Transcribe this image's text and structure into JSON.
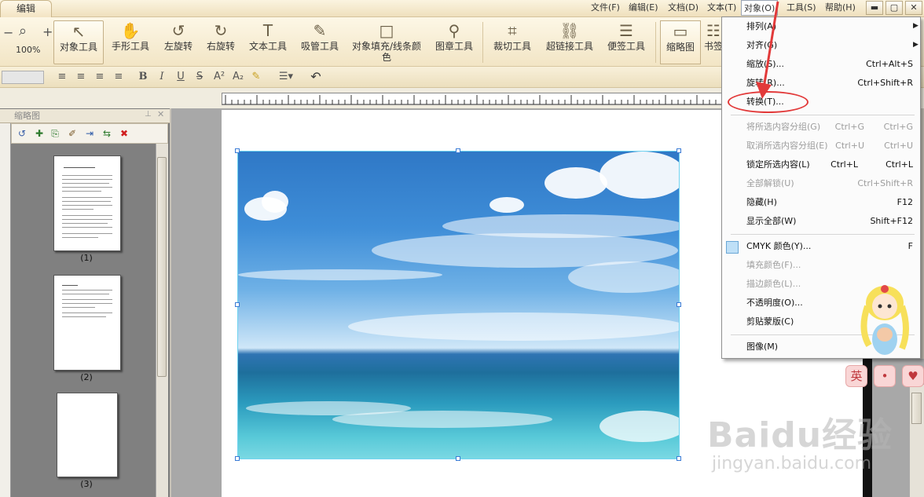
{
  "window": {
    "tab_label": "编辑",
    "minimize": "▬",
    "maximize": "▢",
    "close": "✕"
  },
  "menubar": [
    "文件(F)",
    "编辑(E)",
    "文档(D)",
    "文本(T)",
    "对象(O)",
    "工具(S)",
    "帮助(H)"
  ],
  "toolbar": {
    "zoom_value": "100%",
    "tools": [
      "对象工具",
      "手形工具",
      "左旋转",
      "右旋转",
      "文本工具",
      "吸管工具",
      "对象填充/线条颜色",
      "图章工具",
      "裁切工具",
      "超链接工具",
      "便签工具",
      "缩略图",
      "书签"
    ]
  },
  "thumbnail_panel": {
    "title": "缩略图",
    "pages": [
      "(1)",
      "(2)",
      "(3)"
    ]
  },
  "object_menu": {
    "items": [
      {
        "label": "排列(A)",
        "shortcut": "",
        "submenu": true,
        "enabled": true
      },
      {
        "label": "对齐(G)",
        "shortcut": "",
        "submenu": true,
        "enabled": true
      },
      {
        "label": "缩放(S)...",
        "shortcut": "Ctrl+Alt+S",
        "submenu": false,
        "enabled": true
      },
      {
        "label": "旋转(R)...",
        "shortcut": "Ctrl+Shift+R",
        "submenu": false,
        "enabled": true
      },
      {
        "label": "转换(T)...",
        "shortcut": "",
        "submenu": false,
        "enabled": true
      },
      {
        "label": "将所选内容分组(G)",
        "shortcut": "Ctrl+G",
        "shortcut2": "Ctrl+G",
        "enabled": false
      },
      {
        "label": "取消所选内容分组(E)",
        "shortcut": "Ctrl+U",
        "shortcut2": "Ctrl+U",
        "enabled": false
      },
      {
        "label": "锁定所选内容(L)",
        "shortcut": "Ctrl+L",
        "shortcut2": "Ctrl+L",
        "enabled": true
      },
      {
        "label": "全部解锁(U)",
        "shortcut": "Ctrl+Shift+R",
        "enabled": false
      },
      {
        "label": "隐藏(H)",
        "shortcut": "F12",
        "enabled": true
      },
      {
        "label": "显示全部(W)",
        "shortcut": "Shift+F12",
        "enabled": true
      },
      {
        "label": "CMYK 颜色(Y)...",
        "shortcut": "F",
        "enabled": true
      },
      {
        "label": "填充颜色(F)...",
        "shortcut": "",
        "enabled": false
      },
      {
        "label": "描边颜色(L)...",
        "shortcut": "",
        "enabled": false
      },
      {
        "label": "不透明度(O)...",
        "shortcut": "",
        "enabled": true
      },
      {
        "label": "剪贴蒙版(C)",
        "shortcut": "",
        "enabled": true
      },
      {
        "label": "图像(M)",
        "shortcut": "",
        "enabled": true
      }
    ]
  },
  "overlay": {
    "badge_left": "英",
    "badge_mid": "•",
    "badge_right": "♥"
  },
  "watermark": {
    "main": "Baidu经验",
    "sub": "jingyan.baidu.com"
  },
  "colors": {
    "accent_red": "#e23a3a",
    "menu_bg": "#fbfbfb",
    "toolbar_bg": "#f4e8c9"
  }
}
